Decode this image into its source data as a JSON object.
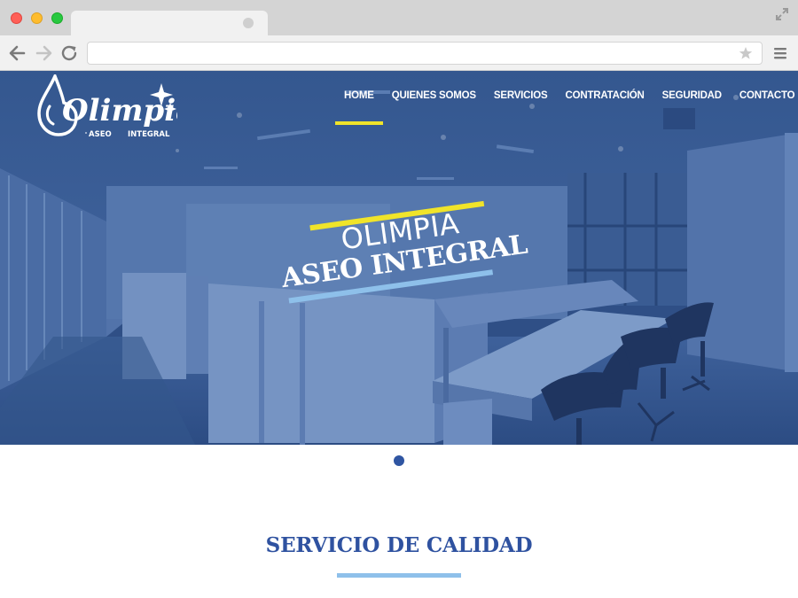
{
  "browser": {
    "url_value": "",
    "icons": [
      "arrow-left-icon",
      "arrow-right-icon",
      "reload-icon",
      "star-icon",
      "hamburger-menu-icon",
      "expand-icon"
    ],
    "window_colors": {
      "close": "#ff5f57",
      "minimize": "#febc2e",
      "maximize": "#28c840"
    }
  },
  "site": {
    "logo": {
      "name": "Olimpia",
      "tagline_left": "ASEO",
      "tagline_right": "INTEGRAL"
    },
    "nav": [
      {
        "label": "HOME",
        "active": true
      },
      {
        "label": "QUIENES SOMOS",
        "active": false
      },
      {
        "label": "SERVICIOS",
        "active": false
      },
      {
        "label": "CONTRATACIÓN",
        "active": false
      },
      {
        "label": "SEGURIDAD",
        "active": false
      },
      {
        "label": "CONTACTO",
        "active": false
      }
    ],
    "hero": {
      "line1": "OLIMPIA",
      "line2": "ASEO INTEGRAL"
    },
    "slider": {
      "current": 1,
      "total": 1
    },
    "section": {
      "title": "SERVICIO DE CALIDAD"
    },
    "colors": {
      "primary": "#2f52a0",
      "accent_yellow": "#f0e42a",
      "accent_light_blue": "#8ec0ea",
      "hero_overlay": "#2f4f86"
    }
  }
}
